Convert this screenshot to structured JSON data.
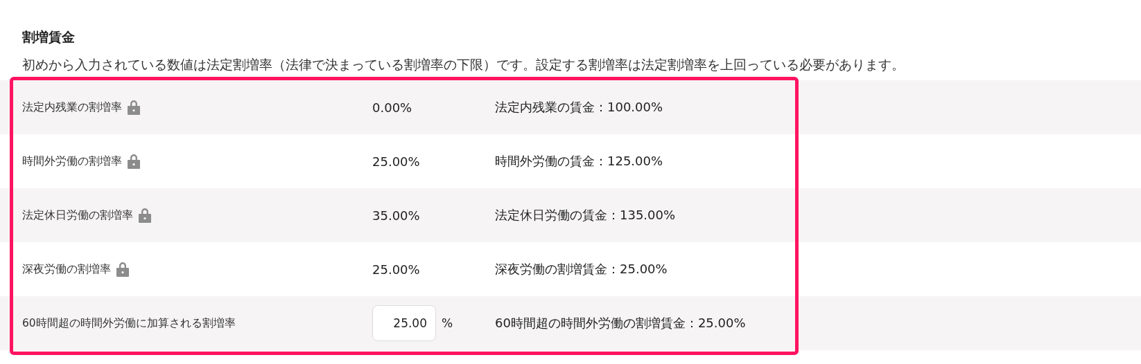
{
  "title": "割増賃金",
  "description": "初めから入力されている数値は法定割増率（法律で決まっている割増率の下限）です。設定する割増率は法定割増率を上回っている必要があります。",
  "rows": [
    {
      "label": "法定内残業の割増率",
      "locked": true,
      "kind": "text",
      "value": "0.00%",
      "wage": "法定内残業の賃金：100.00%"
    },
    {
      "label": "時間外労働の割増率",
      "locked": true,
      "kind": "text",
      "value": "25.00%",
      "wage": "時間外労働の賃金：125.00%"
    },
    {
      "label": "法定休日労働の割増率",
      "locked": true,
      "kind": "text",
      "value": "35.00%",
      "wage": "法定休日労働の賃金：135.00%"
    },
    {
      "label": "深夜労働の割増率",
      "locked": true,
      "kind": "text",
      "value": "25.00%",
      "wage": "深夜労働の割増賃金：25.00%"
    },
    {
      "label": "60時間超の時間外労働に加算される割増率",
      "locked": false,
      "kind": "input",
      "value": "25.00",
      "unit": "%",
      "wage": "60時間超の時間外労働の割増賃金：25.00%"
    }
  ]
}
